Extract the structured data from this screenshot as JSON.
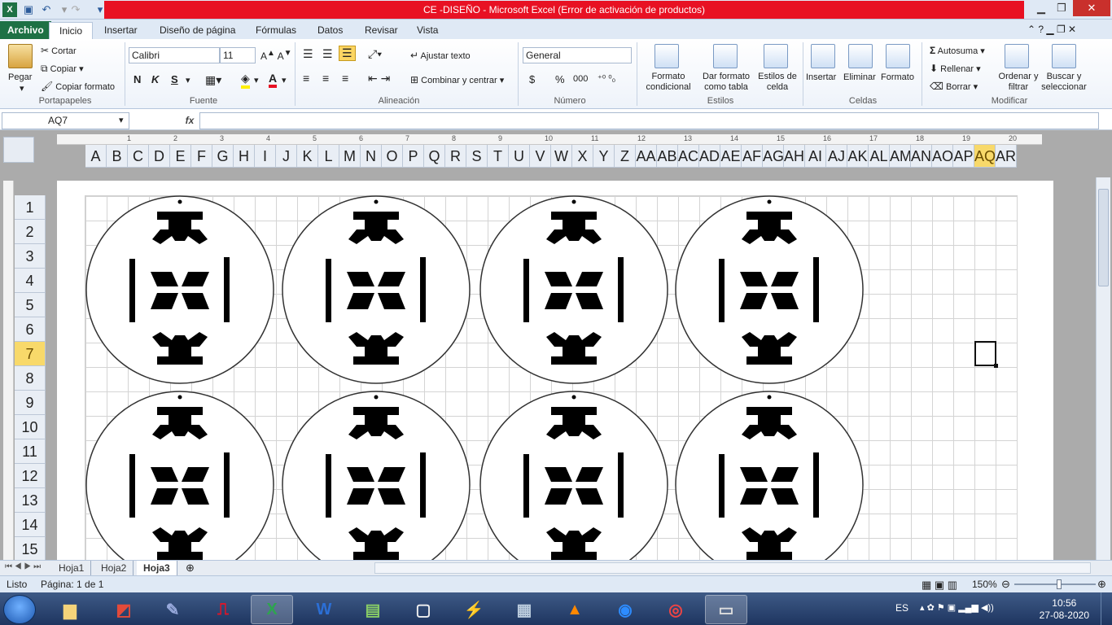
{
  "window": {
    "title": "CE  -DISEÑO  -  Microsoft Excel (Error de activación de productos)"
  },
  "tabs": [
    "Archivo",
    "Inicio",
    "Insertar",
    "Diseño de página",
    "Fórmulas",
    "Datos",
    "Revisar",
    "Vista"
  ],
  "ribbon": {
    "clipboard": {
      "paste": "Pegar",
      "cut": "Cortar",
      "copy": "Copiar",
      "format_painter": "Copiar formato",
      "label": "Portapapeles"
    },
    "font": {
      "name": "Calibri",
      "size": "11",
      "bold": "N",
      "italic": "K",
      "underline": "S",
      "label": "Fuente"
    },
    "alignment": {
      "wrap": "Ajustar texto",
      "merge": "Combinar y centrar",
      "label": "Alineación"
    },
    "number": {
      "format": "General",
      "currency": "$",
      "percent": "%",
      "thousands": "000",
      "label": "Número"
    },
    "styles": {
      "conditional": "Formato condicional",
      "as_table": "Dar formato como tabla",
      "cell_styles": "Estilos de celda",
      "label": "Estilos"
    },
    "cells": {
      "insert": "Insertar",
      "delete": "Eliminar",
      "format": "Formato",
      "label": "Celdas"
    },
    "editing": {
      "autosum": "Autosuma",
      "fill": "Rellenar",
      "clear": "Borrar",
      "sort": "Ordenar y filtrar",
      "find": "Buscar y seleccionar",
      "label": "Modificar"
    }
  },
  "formula_bar": {
    "name_box": "AQ7",
    "fx": "fx",
    "value": ""
  },
  "ruler_numbers": [
    "1",
    "2",
    "3",
    "4",
    "5",
    "6",
    "7",
    "8",
    "9",
    "10",
    "11",
    "12",
    "13",
    "14",
    "15",
    "16",
    "17",
    "18",
    "19",
    "20"
  ],
  "columns": [
    "A",
    "B",
    "C",
    "D",
    "E",
    "F",
    "G",
    "H",
    "I",
    "J",
    "K",
    "L",
    "M",
    "N",
    "O",
    "P",
    "Q",
    "R",
    "S",
    "T",
    "U",
    "V",
    "W",
    "X",
    "Y",
    "Z",
    "AA",
    "AB",
    "AC",
    "AD",
    "AE",
    "AF",
    "AG",
    "AH",
    "AI",
    "AJ",
    "AK",
    "AL",
    "AM",
    "AN",
    "AO",
    "AP",
    "AQ",
    "AR"
  ],
  "selected_column": "AQ",
  "rows": [
    "1",
    "2",
    "3",
    "4",
    "5",
    "6",
    "7",
    "8",
    "9",
    "10",
    "11",
    "12",
    "13",
    "14",
    "15"
  ],
  "selected_row": "7",
  "sheet_tabs": [
    "Hoja1",
    "Hoja2",
    "Hoja3"
  ],
  "active_sheet": "Hoja3",
  "status": {
    "ready": "Listo",
    "page": "Página: 1 de 1",
    "zoom": "150%"
  },
  "taskbar": {
    "language": "ES",
    "time": "10:56",
    "date": "27-08-2020"
  },
  "colors": {
    "title_error": "#e81123",
    "archivo": "#1e7145",
    "selected_header": "#f8d96a"
  }
}
